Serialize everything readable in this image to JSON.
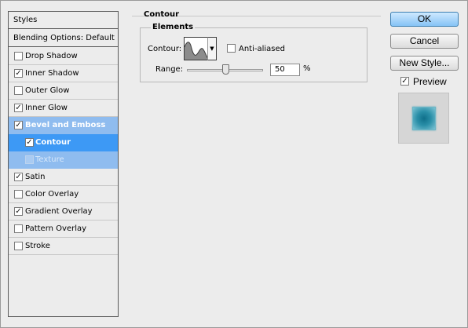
{
  "styles_panel": {
    "header": "Styles",
    "blending": "Blending Options: Default",
    "items": [
      {
        "label": "Drop Shadow",
        "checked": false
      },
      {
        "label": "Inner Shadow",
        "checked": true
      },
      {
        "label": "Outer Glow",
        "checked": false
      },
      {
        "label": "Inner Glow",
        "checked": true
      },
      {
        "label": "Bevel and Emboss",
        "checked": true
      },
      {
        "label": "Contour",
        "checked": true
      },
      {
        "label": "Texture",
        "checked": false
      },
      {
        "label": "Satin",
        "checked": true
      },
      {
        "label": "Color Overlay",
        "checked": false
      },
      {
        "label": "Gradient Overlay",
        "checked": true
      },
      {
        "label": "Pattern Overlay",
        "checked": false
      },
      {
        "label": "Stroke",
        "checked": false
      }
    ]
  },
  "contour": {
    "group_title": "Contour",
    "elements_title": "Elements",
    "contour_label": "Contour:",
    "anti_aliased_label": "Anti-aliased",
    "anti_aliased": false,
    "range_label": "Range:",
    "range_value": "50",
    "range_unit": "%"
  },
  "buttons": {
    "ok": "OK",
    "cancel": "Cancel",
    "new_style": "New Style..."
  },
  "preview": {
    "label": "Preview",
    "checked": true
  },
  "colors": {
    "selection_strong": "#3d99f5",
    "selection_soft": "#8fbcef",
    "preview_swatch": "#1a7f97"
  }
}
